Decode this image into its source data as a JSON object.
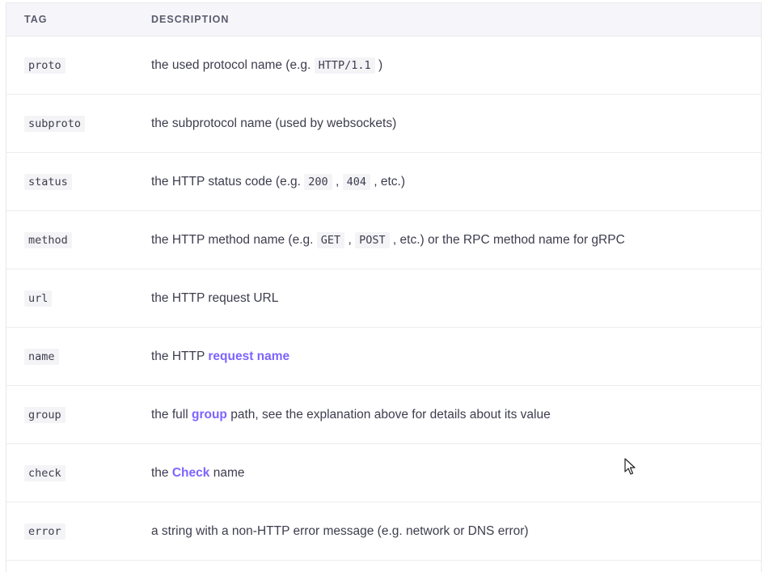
{
  "table": {
    "headers": {
      "tag": "TAG",
      "description": "DESCRIPTION"
    },
    "rows": [
      {
        "tag": "proto",
        "desc": {
          "a": "the used protocol name (e.g. ",
          "c1": "HTTP/1.1",
          "b": " )"
        }
      },
      {
        "tag": "subproto",
        "desc": {
          "a": "the subprotocol name (used by websockets)"
        }
      },
      {
        "tag": "status",
        "desc": {
          "a": "the HTTP status code (e.g. ",
          "c1": "200",
          "b": " , ",
          "c2": "404",
          "c": " , etc.)"
        }
      },
      {
        "tag": "method",
        "desc": {
          "a": "the HTTP method name (e.g. ",
          "c1": "GET",
          "b": " , ",
          "c2": "POST",
          "c": " , etc.) or the RPC method name for gRPC"
        }
      },
      {
        "tag": "url",
        "desc": {
          "a": "the HTTP request URL"
        }
      },
      {
        "tag": "name",
        "desc": {
          "a": "the HTTP ",
          "link": "request name"
        }
      },
      {
        "tag": "group",
        "desc": {
          "a": "the full ",
          "link": "group",
          "b": " path, see the explanation above for details about its value"
        }
      },
      {
        "tag": "check",
        "desc": {
          "a": "the ",
          "link": "Check",
          "b": " name"
        }
      },
      {
        "tag": "error",
        "desc": {
          "a": "a string with a non-HTTP error message (e.g. network or DNS error)"
        }
      }
    ]
  },
  "colors": {
    "link": "#7d64ff",
    "header_bg": "#f6f6fa",
    "code_bg": "#f4f4f7"
  },
  "cursor": {
    "icon": "mouse-pointer-icon"
  }
}
